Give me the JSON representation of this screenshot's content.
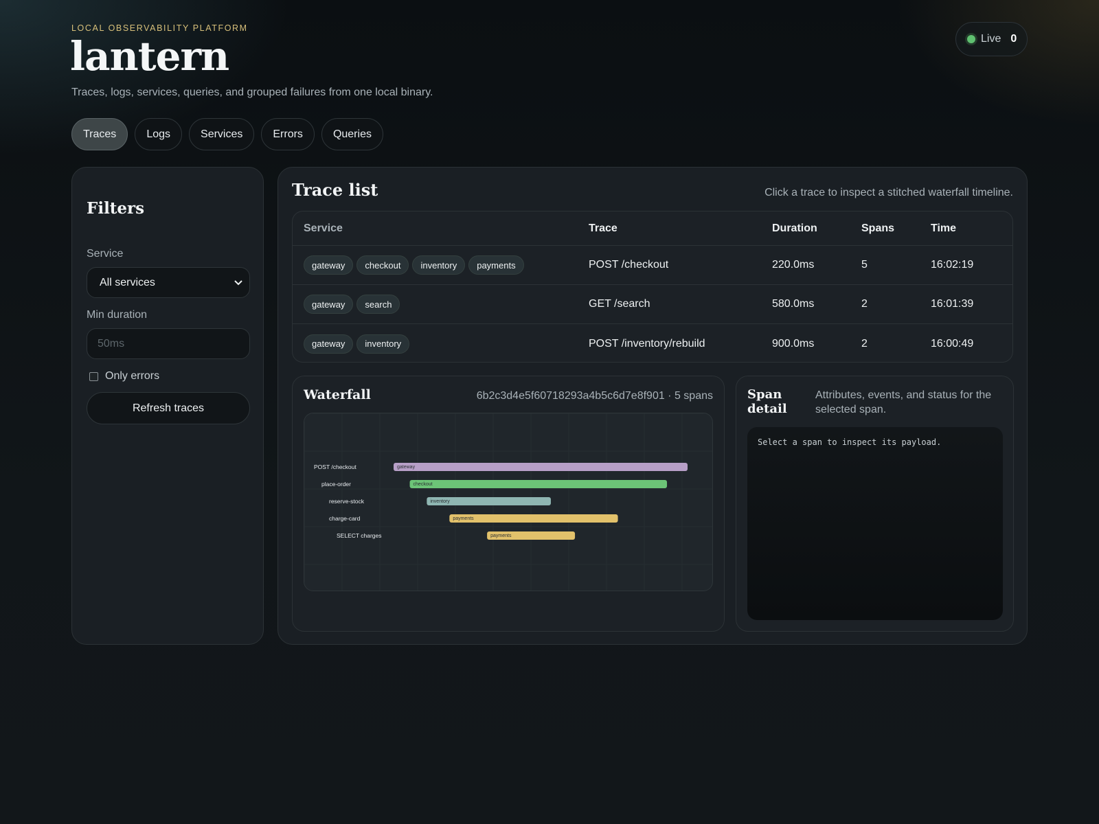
{
  "header": {
    "eyebrow": "LOCAL OBSERVABILITY PLATFORM",
    "brand": "lantern",
    "tagline": "Traces, logs, services, queries, and grouped failures from one local binary.",
    "live_label": "Live",
    "live_count": "0"
  },
  "tabs": [
    {
      "label": "Traces",
      "active": true
    },
    {
      "label": "Logs",
      "active": false
    },
    {
      "label": "Services",
      "active": false
    },
    {
      "label": "Errors",
      "active": false
    },
    {
      "label": "Queries",
      "active": false
    }
  ],
  "filters": {
    "title": "Filters",
    "service_label": "Service",
    "service_value": "All services",
    "min_duration_label": "Min duration",
    "min_duration_placeholder": "50ms",
    "only_errors_label": "Only errors",
    "refresh_label": "Refresh traces"
  },
  "trace_list": {
    "title": "Trace list",
    "hint": "Click a trace to inspect a stitched waterfall timeline.",
    "columns": [
      "Service",
      "Trace",
      "Duration",
      "Spans",
      "Time"
    ],
    "rows": [
      {
        "services": [
          "gateway",
          "checkout",
          "inventory",
          "payments"
        ],
        "trace": "POST /checkout",
        "duration": "220.0ms",
        "spans": "5",
        "time": "16:02:19"
      },
      {
        "services": [
          "gateway",
          "search"
        ],
        "trace": "GET /search",
        "duration": "580.0ms",
        "spans": "2",
        "time": "16:01:39"
      },
      {
        "services": [
          "gateway",
          "inventory"
        ],
        "trace": "POST /inventory/rebuild",
        "duration": "900.0ms",
        "spans": "2",
        "time": "16:00:49"
      }
    ]
  },
  "waterfall": {
    "title": "Waterfall",
    "meta": "6b2c3d4e5f60718293a4b5c6d7e8f901 · 5 spans",
    "spans": [
      {
        "name": "POST /checkout",
        "service": "gateway",
        "depth": 0,
        "start": 0,
        "end": 1.0,
        "color": "#b79fc7"
      },
      {
        "name": "place-order",
        "service": "checkout",
        "depth": 1,
        "start": 0.055,
        "end": 0.93,
        "color": "#6cc477"
      },
      {
        "name": "reserve-stock",
        "service": "inventory",
        "depth": 2,
        "start": 0.113,
        "end": 0.535,
        "color": "#8fb6b2"
      },
      {
        "name": "charge-card",
        "service": "payments",
        "depth": 2,
        "start": 0.19,
        "end": 0.763,
        "color": "#e2c16b"
      },
      {
        "name": "SELECT charges",
        "service": "payments",
        "depth": 3,
        "start": 0.318,
        "end": 0.617,
        "color": "#e2c16b"
      }
    ]
  },
  "span_detail": {
    "title": "Span detail",
    "hint": "Attributes, events, and status for the selected span.",
    "placeholder": "Select a span to inspect its payload."
  },
  "colors": {
    "accent_gold": "#d8c07a",
    "live_green": "#5fc070"
  }
}
